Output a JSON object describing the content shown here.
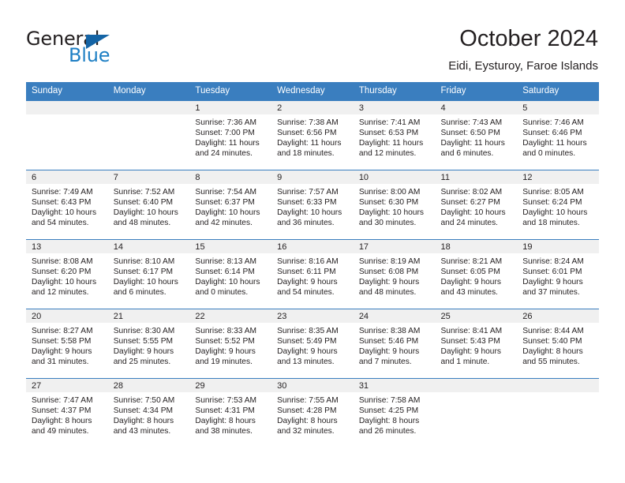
{
  "logo": {
    "word_top": "General",
    "word_bottom": "Blue",
    "triangle_color": "#1464a5",
    "blue_text_color": "#1e7fc4"
  },
  "header": {
    "title": "October 2024",
    "subtitle": "Eidi, Eysturoy, Faroe Islands"
  },
  "theme": {
    "header_blue": "#3a7ebf",
    "daynum_band": "#f0f0f0",
    "text": "#231f20"
  },
  "calendar": {
    "weekday_headers": [
      "Sunday",
      "Monday",
      "Tuesday",
      "Wednesday",
      "Thursday",
      "Friday",
      "Saturday"
    ],
    "weeks": [
      [
        {
          "day": "",
          "sunrise": "",
          "sunset": "",
          "daylight_line1": "",
          "daylight_line2": ""
        },
        {
          "day": "",
          "sunrise": "",
          "sunset": "",
          "daylight_line1": "",
          "daylight_line2": ""
        },
        {
          "day": "1",
          "sunrise": "Sunrise: 7:36 AM",
          "sunset": "Sunset: 7:00 PM",
          "daylight_line1": "Daylight: 11 hours",
          "daylight_line2": "and 24 minutes."
        },
        {
          "day": "2",
          "sunrise": "Sunrise: 7:38 AM",
          "sunset": "Sunset: 6:56 PM",
          "daylight_line1": "Daylight: 11 hours",
          "daylight_line2": "and 18 minutes."
        },
        {
          "day": "3",
          "sunrise": "Sunrise: 7:41 AM",
          "sunset": "Sunset: 6:53 PM",
          "daylight_line1": "Daylight: 11 hours",
          "daylight_line2": "and 12 minutes."
        },
        {
          "day": "4",
          "sunrise": "Sunrise: 7:43 AM",
          "sunset": "Sunset: 6:50 PM",
          "daylight_line1": "Daylight: 11 hours",
          "daylight_line2": "and 6 minutes."
        },
        {
          "day": "5",
          "sunrise": "Sunrise: 7:46 AM",
          "sunset": "Sunset: 6:46 PM",
          "daylight_line1": "Daylight: 11 hours",
          "daylight_line2": "and 0 minutes."
        }
      ],
      [
        {
          "day": "6",
          "sunrise": "Sunrise: 7:49 AM",
          "sunset": "Sunset: 6:43 PM",
          "daylight_line1": "Daylight: 10 hours",
          "daylight_line2": "and 54 minutes."
        },
        {
          "day": "7",
          "sunrise": "Sunrise: 7:52 AM",
          "sunset": "Sunset: 6:40 PM",
          "daylight_line1": "Daylight: 10 hours",
          "daylight_line2": "and 48 minutes."
        },
        {
          "day": "8",
          "sunrise": "Sunrise: 7:54 AM",
          "sunset": "Sunset: 6:37 PM",
          "daylight_line1": "Daylight: 10 hours",
          "daylight_line2": "and 42 minutes."
        },
        {
          "day": "9",
          "sunrise": "Sunrise: 7:57 AM",
          "sunset": "Sunset: 6:33 PM",
          "daylight_line1": "Daylight: 10 hours",
          "daylight_line2": "and 36 minutes."
        },
        {
          "day": "10",
          "sunrise": "Sunrise: 8:00 AM",
          "sunset": "Sunset: 6:30 PM",
          "daylight_line1": "Daylight: 10 hours",
          "daylight_line2": "and 30 minutes."
        },
        {
          "day": "11",
          "sunrise": "Sunrise: 8:02 AM",
          "sunset": "Sunset: 6:27 PM",
          "daylight_line1": "Daylight: 10 hours",
          "daylight_line2": "and 24 minutes."
        },
        {
          "day": "12",
          "sunrise": "Sunrise: 8:05 AM",
          "sunset": "Sunset: 6:24 PM",
          "daylight_line1": "Daylight: 10 hours",
          "daylight_line2": "and 18 minutes."
        }
      ],
      [
        {
          "day": "13",
          "sunrise": "Sunrise: 8:08 AM",
          "sunset": "Sunset: 6:20 PM",
          "daylight_line1": "Daylight: 10 hours",
          "daylight_line2": "and 12 minutes."
        },
        {
          "day": "14",
          "sunrise": "Sunrise: 8:10 AM",
          "sunset": "Sunset: 6:17 PM",
          "daylight_line1": "Daylight: 10 hours",
          "daylight_line2": "and 6 minutes."
        },
        {
          "day": "15",
          "sunrise": "Sunrise: 8:13 AM",
          "sunset": "Sunset: 6:14 PM",
          "daylight_line1": "Daylight: 10 hours",
          "daylight_line2": "and 0 minutes."
        },
        {
          "day": "16",
          "sunrise": "Sunrise: 8:16 AM",
          "sunset": "Sunset: 6:11 PM",
          "daylight_line1": "Daylight: 9 hours",
          "daylight_line2": "and 54 minutes."
        },
        {
          "day": "17",
          "sunrise": "Sunrise: 8:19 AM",
          "sunset": "Sunset: 6:08 PM",
          "daylight_line1": "Daylight: 9 hours",
          "daylight_line2": "and 48 minutes."
        },
        {
          "day": "18",
          "sunrise": "Sunrise: 8:21 AM",
          "sunset": "Sunset: 6:05 PM",
          "daylight_line1": "Daylight: 9 hours",
          "daylight_line2": "and 43 minutes."
        },
        {
          "day": "19",
          "sunrise": "Sunrise: 8:24 AM",
          "sunset": "Sunset: 6:01 PM",
          "daylight_line1": "Daylight: 9 hours",
          "daylight_line2": "and 37 minutes."
        }
      ],
      [
        {
          "day": "20",
          "sunrise": "Sunrise: 8:27 AM",
          "sunset": "Sunset: 5:58 PM",
          "daylight_line1": "Daylight: 9 hours",
          "daylight_line2": "and 31 minutes."
        },
        {
          "day": "21",
          "sunrise": "Sunrise: 8:30 AM",
          "sunset": "Sunset: 5:55 PM",
          "daylight_line1": "Daylight: 9 hours",
          "daylight_line2": "and 25 minutes."
        },
        {
          "day": "22",
          "sunrise": "Sunrise: 8:33 AM",
          "sunset": "Sunset: 5:52 PM",
          "daylight_line1": "Daylight: 9 hours",
          "daylight_line2": "and 19 minutes."
        },
        {
          "day": "23",
          "sunrise": "Sunrise: 8:35 AM",
          "sunset": "Sunset: 5:49 PM",
          "daylight_line1": "Daylight: 9 hours",
          "daylight_line2": "and 13 minutes."
        },
        {
          "day": "24",
          "sunrise": "Sunrise: 8:38 AM",
          "sunset": "Sunset: 5:46 PM",
          "daylight_line1": "Daylight: 9 hours",
          "daylight_line2": "and 7 minutes."
        },
        {
          "day": "25",
          "sunrise": "Sunrise: 8:41 AM",
          "sunset": "Sunset: 5:43 PM",
          "daylight_line1": "Daylight: 9 hours",
          "daylight_line2": "and 1 minute."
        },
        {
          "day": "26",
          "sunrise": "Sunrise: 8:44 AM",
          "sunset": "Sunset: 5:40 PM",
          "daylight_line1": "Daylight: 8 hours",
          "daylight_line2": "and 55 minutes."
        }
      ],
      [
        {
          "day": "27",
          "sunrise": "Sunrise: 7:47 AM",
          "sunset": "Sunset: 4:37 PM",
          "daylight_line1": "Daylight: 8 hours",
          "daylight_line2": "and 49 minutes."
        },
        {
          "day": "28",
          "sunrise": "Sunrise: 7:50 AM",
          "sunset": "Sunset: 4:34 PM",
          "daylight_line1": "Daylight: 8 hours",
          "daylight_line2": "and 43 minutes."
        },
        {
          "day": "29",
          "sunrise": "Sunrise: 7:53 AM",
          "sunset": "Sunset: 4:31 PM",
          "daylight_line1": "Daylight: 8 hours",
          "daylight_line2": "and 38 minutes."
        },
        {
          "day": "30",
          "sunrise": "Sunrise: 7:55 AM",
          "sunset": "Sunset: 4:28 PM",
          "daylight_line1": "Daylight: 8 hours",
          "daylight_line2": "and 32 minutes."
        },
        {
          "day": "31",
          "sunrise": "Sunrise: 7:58 AM",
          "sunset": "Sunset: 4:25 PM",
          "daylight_line1": "Daylight: 8 hours",
          "daylight_line2": "and 26 minutes."
        },
        {
          "day": "",
          "sunrise": "",
          "sunset": "",
          "daylight_line1": "",
          "daylight_line2": ""
        },
        {
          "day": "",
          "sunrise": "",
          "sunset": "",
          "daylight_line1": "",
          "daylight_line2": ""
        }
      ]
    ]
  }
}
